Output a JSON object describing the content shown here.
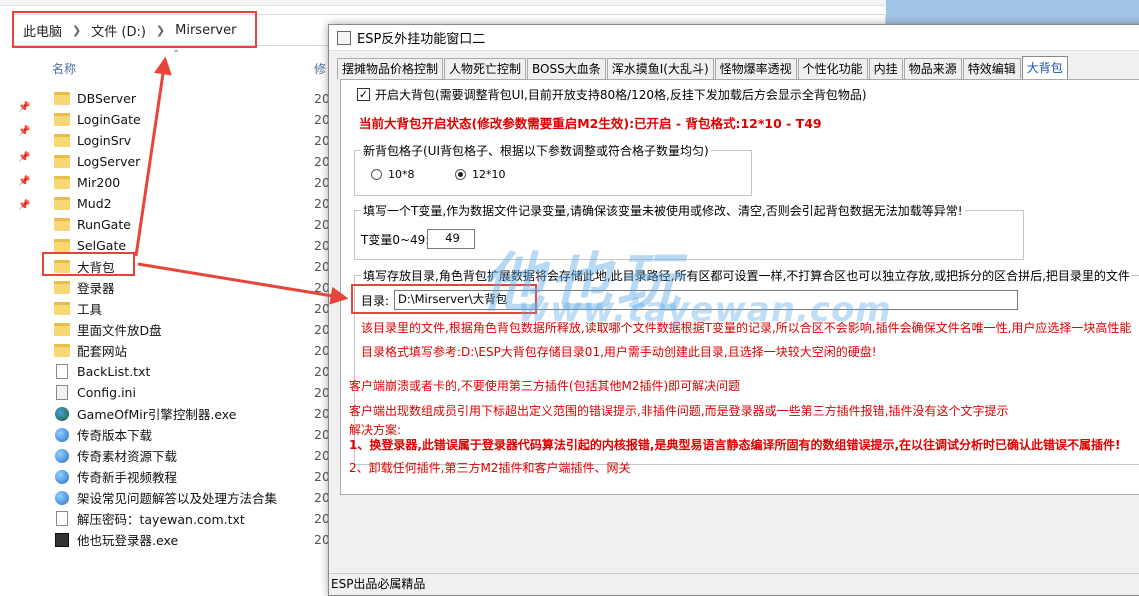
{
  "explorer": {
    "breadcrumb": [
      "此电脑",
      "文件 (D:)",
      "Mirserver"
    ],
    "column_name": "名称",
    "column_modified": "修",
    "files": [
      {
        "name": "DBServer",
        "type": "folder",
        "date": "20"
      },
      {
        "name": "LoginGate",
        "type": "folder",
        "date": "20"
      },
      {
        "name": "LoginSrv",
        "type": "folder",
        "date": "20"
      },
      {
        "name": "LogServer",
        "type": "folder",
        "date": "20"
      },
      {
        "name": "Mir200",
        "type": "folder",
        "date": "20"
      },
      {
        "name": "Mud2",
        "type": "folder",
        "date": "20"
      },
      {
        "name": "RunGate",
        "type": "folder",
        "date": "20"
      },
      {
        "name": "SelGate",
        "type": "folder",
        "date": "20"
      },
      {
        "name": "大背包",
        "type": "folder",
        "date": "20"
      },
      {
        "name": "登录器",
        "type": "folder",
        "date": "20"
      },
      {
        "name": "工具",
        "type": "folder",
        "date": "20"
      },
      {
        "name": "里面文件放D盘",
        "type": "folder",
        "date": "20"
      },
      {
        "name": "配套网站",
        "type": "folder",
        "date": "20"
      },
      {
        "name": "BackList.txt",
        "type": "txt",
        "date": "20"
      },
      {
        "name": "Config.ini",
        "type": "ini",
        "date": "20"
      },
      {
        "name": "GameOfMir引擎控制器.exe",
        "type": "exe",
        "date": "20"
      },
      {
        "name": "传奇版本下载",
        "type": "url",
        "date": "20"
      },
      {
        "name": "传奇素材资源下载",
        "type": "url",
        "date": "20"
      },
      {
        "name": "传奇新手视频教程",
        "type": "url",
        "date": "20"
      },
      {
        "name": "架设常见问题解答以及处理方法合集",
        "type": "url",
        "date": "20"
      },
      {
        "name": "解压密码：tayewan.com.txt",
        "type": "txt",
        "date": "20"
      },
      {
        "name": "他也玩登录器.exe",
        "type": "exe2",
        "date": "20"
      }
    ]
  },
  "esp": {
    "title": "ESP反外挂功能窗口二",
    "tabs": [
      "摆摊物品价格控制",
      "人物死亡控制",
      "BOSS大血条",
      "浑水摸鱼I(大乱斗)",
      "怪物爆率透视",
      "个性化功能",
      "内挂",
      "物品来源",
      "特效编辑",
      "大背包"
    ],
    "active_tab": "大背包",
    "enable_checkbox": "开启大背包(需要调整背包UI,目前开放支持80格/120格,反挂下发加载后方会显示全背包物品)",
    "status_line": "当前大背包开启状态(修改参数需要重启M2生效):已开启 - 背包格式:12*10 - T49",
    "grid_group": {
      "title": "新背包格子(UI背包格子、根据以下参数调整或符合格子数量均匀)",
      "options": [
        "10*8",
        "12*10"
      ],
      "selected": "12*10"
    },
    "tvar_group": {
      "title": "填写一个T变量,作为数据文件记录变量,请确保该变量未被使用或修改、清空,否则会引起背包数据无法加载等异常!",
      "label": "T变量0~49:",
      "value": "49"
    },
    "dir_group": {
      "title": "填写存放目录,角色背包扩展数据将会存储此地,此目录路径,所有区都可设置一样,不打算合区也可以独立存放,或把拆分的区合拼后,把目录里的文件",
      "label": "目录:",
      "value": "D:\\Mirserver\\大背包",
      "note1": "该目录里的文件,根据角色背包数据所释放,读取哪个文件数据根据T变量的记录,所以合区不会影响,插件会确保文件名唯一性,用户应选择一块高性能",
      "note2": "目录格式填写参考:D:\\ESP大背包存储目录01,用户需手动创建此目录,且选择一块较大空闲的硬盘!"
    },
    "help": {
      "line1": "客户端崩溃或者卡的,不要使用第三方插件(包括其他M2插件)即可解决问题",
      "line2": "客户端出现数组成员引用下标超出定义范围的错误提示,非插件问题,而是登录器或一些第三方插件报错,插件没有这个文字提示",
      "line3": "解决方案:",
      "line4": "1、换登录器,此错误属于登录器代码算法引起的内核报错,是典型易语言静态编译所固有的数组错误提示,在以往调试分析时已确认此错误不属插件!",
      "line5": "2、卸载任何插件,第三方M2插件和客户端插件、网关"
    },
    "statusbar": "ESP出品必属精品"
  },
  "watermark": {
    "cn": "他也玩",
    "en": "www.tayewan.com"
  },
  "colors": {
    "highlight": "#e8453a",
    "warning_red": "#e00000",
    "watermark": "#60aae6"
  }
}
